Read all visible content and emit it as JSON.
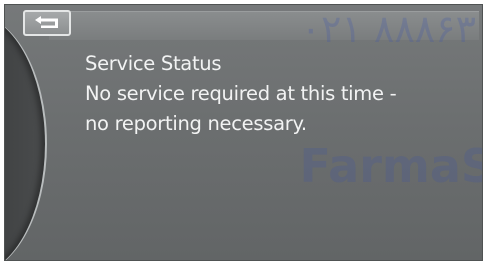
{
  "header": {
    "back_icon": "return-arrow-icon"
  },
  "message": {
    "title": "Service Status",
    "line1": "No service required at this time -",
    "line2": "no reporting necessary."
  },
  "watermark": {
    "phone": "۰۲۱ ۸۸۸۶۳",
    "name": "FarmaS"
  },
  "colors": {
    "screen_bg": "#6c6f70",
    "text": "#f2f3f3",
    "watermark": "#465aaa"
  }
}
